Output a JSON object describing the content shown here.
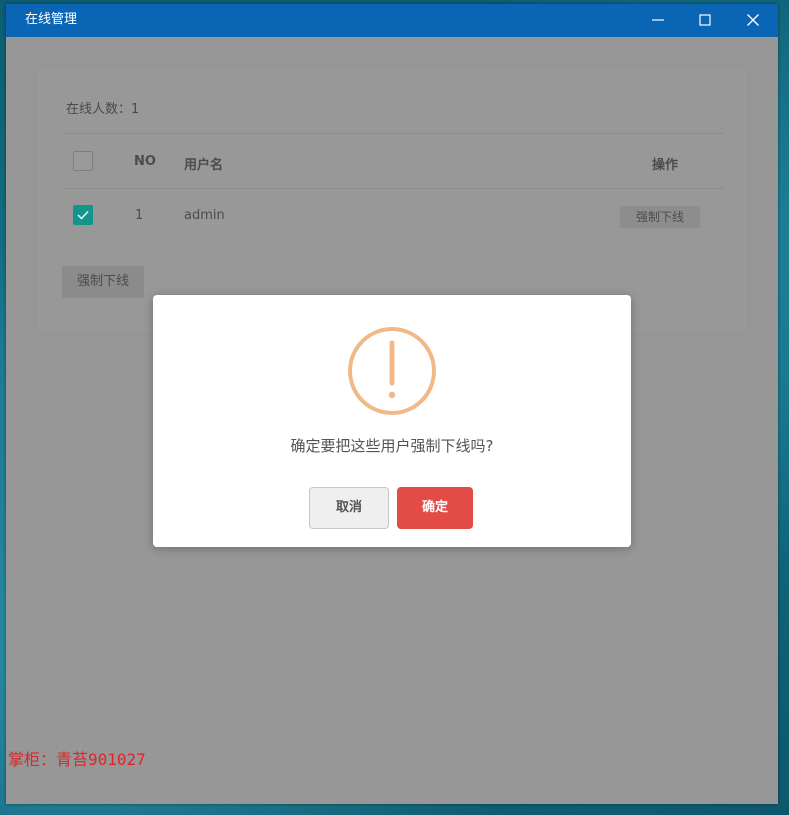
{
  "window": {
    "title": "在线管理",
    "controls": [
      "minimize-icon",
      "maximize-icon",
      "close-icon"
    ]
  },
  "online": {
    "count_label": "在线人数：1"
  },
  "table": {
    "headers": {
      "no": "NO",
      "username": "用户名",
      "action": "操作"
    },
    "rows": [
      {
        "no": "1",
        "username": "admin",
        "action_label": "强制下线",
        "checked": true
      }
    ],
    "select_all_checked": false
  },
  "bulk_action": {
    "label": "强制下线"
  },
  "dialog": {
    "icon": "warning-icon",
    "message": "确定要把这些用户强制下线吗?",
    "cancel_label": "取消",
    "confirm_label": "确定"
  },
  "colors": {
    "titlebar": "#0a66b5",
    "checkbox_checked": "#13958e",
    "warning": "#f0b987",
    "confirm_button": "#e34b47",
    "watermark": "#e0242a"
  },
  "watermark": {
    "text": "掌柜：青苔901027"
  }
}
